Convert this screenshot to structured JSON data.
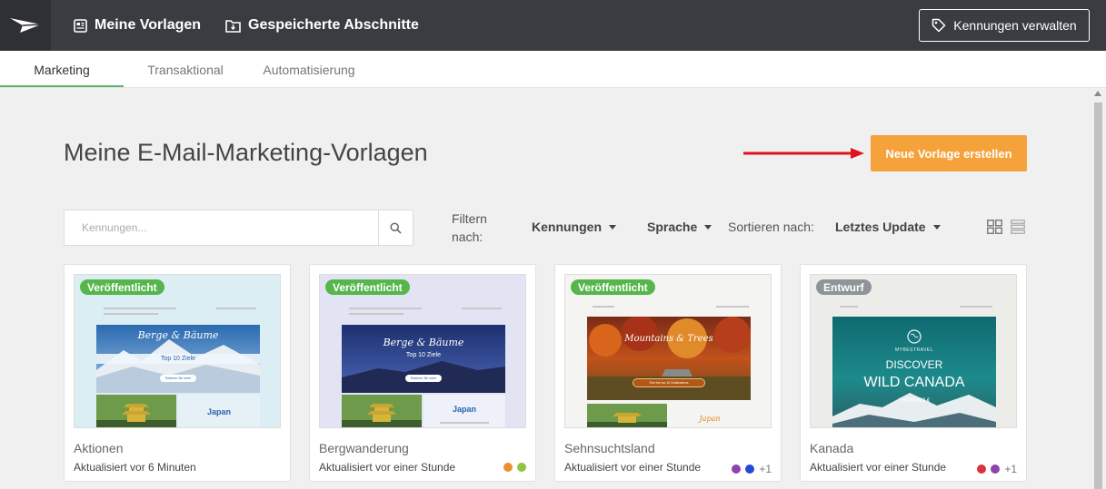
{
  "topbar": {
    "nav": [
      "Meine Vorlagen",
      "Gespeicherte Abschnitte"
    ],
    "manage_button": "Kennungen verwalten"
  },
  "tabs": [
    "Marketing",
    "Transaktional",
    "Automatisierung"
  ],
  "page": {
    "title": "Meine E-Mail-Marketing-Vorlagen",
    "create_button": "Neue Vorlage erstellen"
  },
  "search": {
    "placeholder": "Kennungen..."
  },
  "filters": {
    "label": "Filtern nach:",
    "tags": "Kennungen",
    "language": "Sprache",
    "sort_label": "Sortieren nach:",
    "sort_value": "Letztes Update"
  },
  "cards": [
    {
      "status": "Veröffentlicht",
      "title": "Aktionen",
      "updated": "Aktualisiert vor 6 Minuten",
      "hero_title": "Berge & Bäume",
      "hero_sub": "Top 10 Ziele",
      "hero_btn": "Erfahren Sie mehr",
      "side_label": "Japan",
      "colors": []
    },
    {
      "status": "Veröffentlicht",
      "title": "Bergwanderung",
      "updated": "Aktualisiert vor einer Stunde",
      "hero_title": "Berge & Bäume",
      "hero_sub": "Top 10 Ziele",
      "hero_btn": "Erfahren Sie mehr",
      "side_label": "Japan",
      "colors": [
        "#e8902d",
        "#8dc63f"
      ]
    },
    {
      "status": "Veröffentlicht",
      "title": "Sehnsuchtsland",
      "updated": "Aktualisiert vor einer Stunde",
      "hero_title": "Mountains & Trees",
      "hero_btn": "See the top 10 Destinations",
      "side_label": "Japan",
      "colors": [
        "#8e44ad",
        "#2649d6"
      ],
      "more": "+1"
    },
    {
      "status": "Entwurf",
      "title": "Kanada",
      "updated": "Aktualisiert vor einer Stunde",
      "brand": "MYBESTRAVEL",
      "hero_title": "DISCOVER",
      "hero_sub": "WILD CANADA",
      "price": "FROM 899 €",
      "colors": [
        "#d9333f",
        "#8e44ad"
      ],
      "more": "+1"
    }
  ]
}
